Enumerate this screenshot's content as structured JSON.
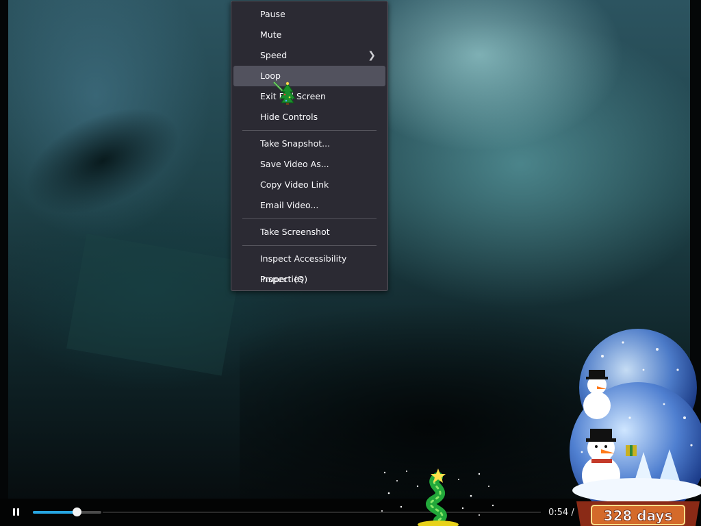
{
  "context_menu": {
    "items": [
      {
        "label": "Pause"
      },
      {
        "label": "Mute"
      },
      {
        "label": "Speed",
        "submenu_icon": "chevron-right-icon"
      },
      {
        "label": "Loop",
        "highlighted": true
      },
      {
        "label": "Exit Full Screen"
      },
      {
        "label": "Hide Controls"
      },
      {
        "label": "Take Snapshot..."
      },
      {
        "label": "Save Video As..."
      },
      {
        "label": "Copy Video Link"
      },
      {
        "label": "Email Video..."
      },
      {
        "label": "Take Screenshot"
      },
      {
        "label": "Inspect Accessibility Properties"
      },
      {
        "label": "Inspect (Q)"
      }
    ]
  },
  "controls": {
    "play_state_icon": "pause-icon",
    "progress_fraction": 0.64,
    "current_time": "0:54 /"
  },
  "overlay": {
    "countdown": "328 days"
  },
  "colors": {
    "menu_bg": "#2b2a33",
    "menu_highlight": "#52525e",
    "progress_accent": "#27a6e2"
  }
}
